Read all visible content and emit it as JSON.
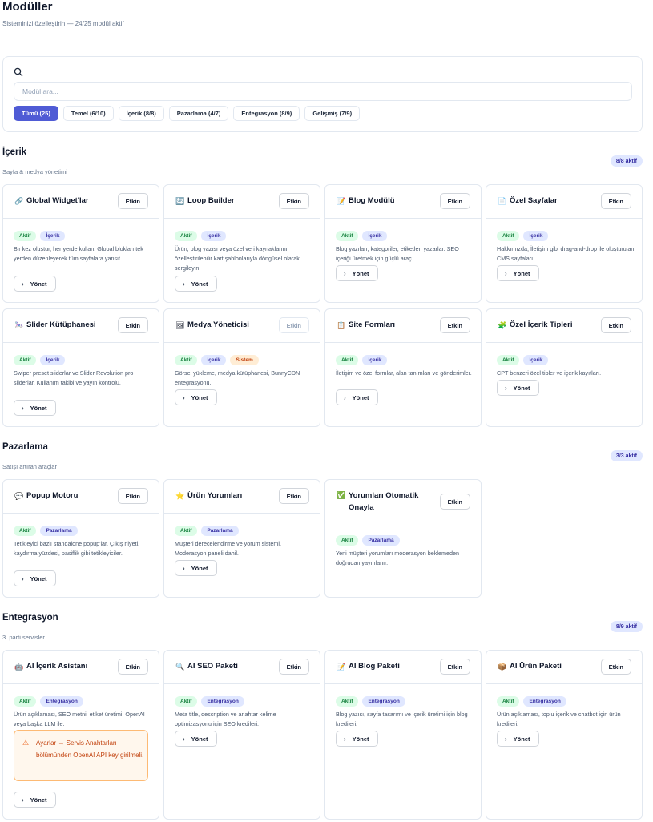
{
  "header": {
    "title": "Modüller",
    "subtitle": "Sisteminizi özelleştirin — 24/25 modül aktif"
  },
  "filters": {
    "search_placeholder": "Modül ara...",
    "chips": [
      "Tümü (25)",
      "Temel (6/10)",
      "İçerik (8/8)",
      "Pazarlama (4/7)",
      "Entegrasyon (8/9)",
      "Gelişmiş (7/9)"
    ]
  },
  "labels": {
    "manage": "Yönet",
    "toggle": "Etkin",
    "aktif": "Aktif"
  },
  "sections": {
    "icerik": {
      "title": "İçerik",
      "subtitle": "Sayfa & medya yönetimi",
      "badge": "8/8 aktif",
      "cards": [
        {
          "title": "Global Widget'lar",
          "icon": "link-icon",
          "category": "İçerik",
          "desc": "Bir kez oluştur, her yerde kullan. Global blokları tek yerden düzenleyerek tüm sayfalara yansıt."
        },
        {
          "title": "Loop Builder",
          "icon": "loop-icon",
          "category": "İçerik",
          "desc": "Ürün, blog yazısı veya özel veri kaynaklarını özelleştirilebilir kart şablonlarıyla döngüsel olarak sergileyin."
        },
        {
          "title": "Blog Modülü",
          "icon": "memo-icon",
          "category": "İçerik",
          "desc": "Blog yazıları, kategoriler, etiketler, yazarlar. SEO içeriği üretmek için güçlü araç."
        },
        {
          "title": "Özel Sayfalar",
          "icon": "page-icon",
          "category": "İçerik",
          "desc": "Hakkımızda, İletişim gibi drag-and-drop ile oluşturulan CMS sayfaları."
        },
        {
          "title": "Slider Kütüphanesi",
          "icon": "slider-icon",
          "category": "İçerik",
          "desc": "Swiper preset sliderlar ve Slider Revolution pro sliderlar. Kullanım takibi ve yayın kontrolü."
        },
        {
          "title": "Medya Yöneticisi",
          "icon": "image-icon",
          "category": "İçerik",
          "extra_tag": "Sistem",
          "desc": "Görsel yükleme, medya kütüphanesi, BunnyCDN entegrasyonu."
        },
        {
          "title": "Site Formları",
          "icon": "clipboard-icon",
          "category": "İçerik",
          "desc": "İletişim ve özel formlar, alan tanımları ve gönderimler."
        },
        {
          "title": "Özel İçerik Tipleri",
          "icon": "puzzle-icon",
          "category": "İçerik",
          "desc": "CPT benzeri özel tipler ve içerik kayıtları."
        }
      ]
    },
    "pazarlama": {
      "title": "Pazarlama",
      "subtitle": "Satışı artıran araçlar",
      "badge": "3/3 aktif",
      "cards": [
        {
          "title": "Popup Motoru",
          "icon": "speech-bubble-icon",
          "category": "Pazarlama",
          "desc": "Tetikleyici bazlı standalone popup'lar. Çıkış niyeti, kaydırma yüzdesi, pasiflik gibi tetikleyiciler."
        },
        {
          "title": "Ürün Yorumları",
          "icon": "star-icon",
          "category": "Pazarlama",
          "desc": "Müşteri derecelendirme ve yorum sistemi. Moderasyon paneli dahil."
        },
        {
          "title": "Yorumları Otomatik Onayla",
          "icon": "check-box-icon",
          "category": "Pazarlama",
          "desc": "Yeni müşteri yorumları moderasyon beklemeden doğrudan yayınlanır."
        }
      ]
    },
    "entegrasyon": {
      "title": "Entegrasyon",
      "subtitle": "3. parti servisler",
      "badge": "8/9 aktif",
      "cards": [
        {
          "title": "AI İçerik Asistanı",
          "icon": "robot-icon",
          "category": "Entegrasyon",
          "desc": "Ürün açıklaması, SEO metni, etiket üretimi. OpenAI veya başka LLM ile.",
          "warning": "Ayarlar → Servis Anahtarları bölümünden OpenAI API key girilmeli."
        },
        {
          "title": "AI SEO Paketi",
          "icon": "magnifier-icon",
          "category": "Entegrasyon",
          "desc": "Meta title, description ve anahtar kelime optimizasyonu için SEO kredileri."
        },
        {
          "title": "AI Blog Paketi",
          "icon": "memo-icon",
          "category": "Entegrasyon",
          "desc": "Blog yazısı, sayfa tasarımı ve içerik üretimi için blog kredileri."
        },
        {
          "title": "AI Ürün Paketi",
          "icon": "package-icon",
          "category": "Entegrasyon",
          "desc": "Ürün açıklaması, toplu içerik ve chatbot için ürün kredileri."
        }
      ]
    }
  }
}
